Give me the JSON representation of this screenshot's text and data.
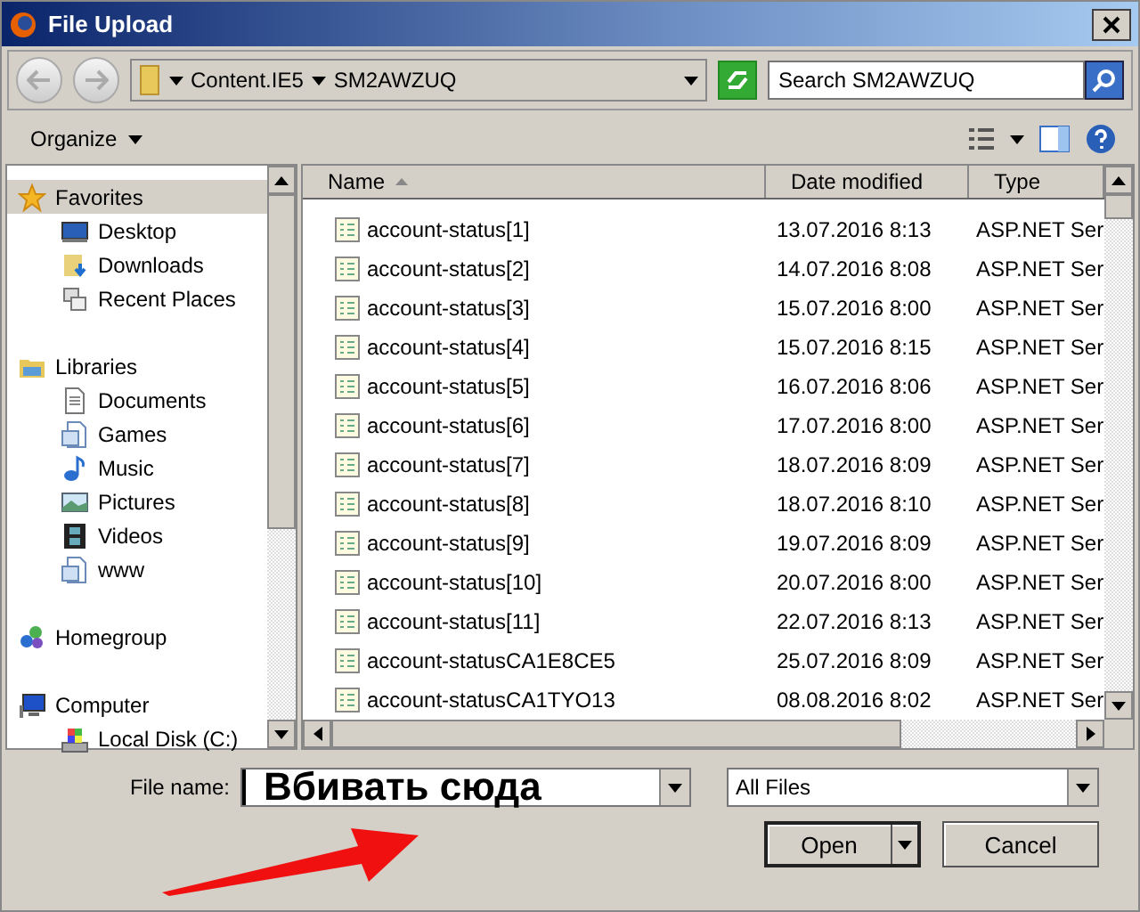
{
  "window": {
    "title": "File Upload"
  },
  "nav": {
    "path": [
      "Content.IE5",
      "SM2AWZUQ"
    ],
    "search": {
      "placeholder": "Search SM2AWZUQ"
    }
  },
  "toolbar": {
    "organize": "Organize"
  },
  "sidebar": {
    "groups": [
      {
        "label": "Favorites",
        "kind": "star",
        "selected": true,
        "children": [
          {
            "label": "Desktop",
            "kind": "desktop",
            "selected": false
          },
          {
            "label": "Downloads",
            "kind": "downloads",
            "selected": false
          },
          {
            "label": "Recent Places",
            "kind": "recent",
            "selected": false
          }
        ]
      },
      {
        "label": "Libraries",
        "kind": "library",
        "selected": false,
        "children": [
          {
            "label": "Documents",
            "kind": "document",
            "selected": false
          },
          {
            "label": "Games",
            "kind": "library-item",
            "selected": false
          },
          {
            "label": "Music",
            "kind": "music",
            "selected": false
          },
          {
            "label": "Pictures",
            "kind": "pictures",
            "selected": false
          },
          {
            "label": "Videos",
            "kind": "videos",
            "selected": false
          },
          {
            "label": "www",
            "kind": "library-item",
            "selected": false
          }
        ]
      },
      {
        "label": "Homegroup",
        "kind": "homegroup",
        "selected": false
      },
      {
        "label": "Computer",
        "kind": "computer",
        "selected": false,
        "children": [
          {
            "label": "Local Disk (C:)",
            "kind": "disk",
            "selected": false
          }
        ]
      }
    ]
  },
  "table": {
    "columns": [
      "Name",
      "Date modified",
      "Type"
    ],
    "rows": [
      {
        "name": "account-status[1]",
        "date": "13.07.2016 8:13",
        "type": "ASP.NET Ser",
        "selected": false
      },
      {
        "name": "account-status[2]",
        "date": "14.07.2016 8:08",
        "type": "ASP.NET Ser",
        "selected": false
      },
      {
        "name": "account-status[3]",
        "date": "15.07.2016 8:00",
        "type": "ASP.NET Ser",
        "selected": false
      },
      {
        "name": "account-status[4]",
        "date": "15.07.2016 8:15",
        "type": "ASP.NET Ser",
        "selected": false
      },
      {
        "name": "account-status[5]",
        "date": "16.07.2016 8:06",
        "type": "ASP.NET Ser",
        "selected": false
      },
      {
        "name": "account-status[6]",
        "date": "17.07.2016 8:00",
        "type": "ASP.NET Ser",
        "selected": false
      },
      {
        "name": "account-status[7]",
        "date": "18.07.2016 8:09",
        "type": "ASP.NET Ser",
        "selected": false
      },
      {
        "name": "account-status[8]",
        "date": "18.07.2016 8:10",
        "type": "ASP.NET Ser",
        "selected": false
      },
      {
        "name": "account-status[9]",
        "date": "19.07.2016 8:09",
        "type": "ASP.NET Ser",
        "selected": false
      },
      {
        "name": "account-status[10]",
        "date": "20.07.2016 8:00",
        "type": "ASP.NET Ser",
        "selected": false
      },
      {
        "name": "account-status[11]",
        "date": "22.07.2016 8:13",
        "type": "ASP.NET Ser",
        "selected": false
      },
      {
        "name": "account-statusCA1E8CE5",
        "date": "25.07.2016 8:09",
        "type": "ASP.NET Ser",
        "selected": false
      },
      {
        "name": "account-statusCA1TYO13",
        "date": "08.08.2016 8:02",
        "type": "ASP.NET Ser",
        "selected": false
      }
    ]
  },
  "file_name": {
    "label": "File name:",
    "value": "Вбивать сюда"
  },
  "file_type": {
    "value": "All Files"
  },
  "buttons": [
    {
      "label": "Open",
      "kind": "split"
    },
    {
      "label": "Cancel",
      "kind": "plain"
    }
  ]
}
